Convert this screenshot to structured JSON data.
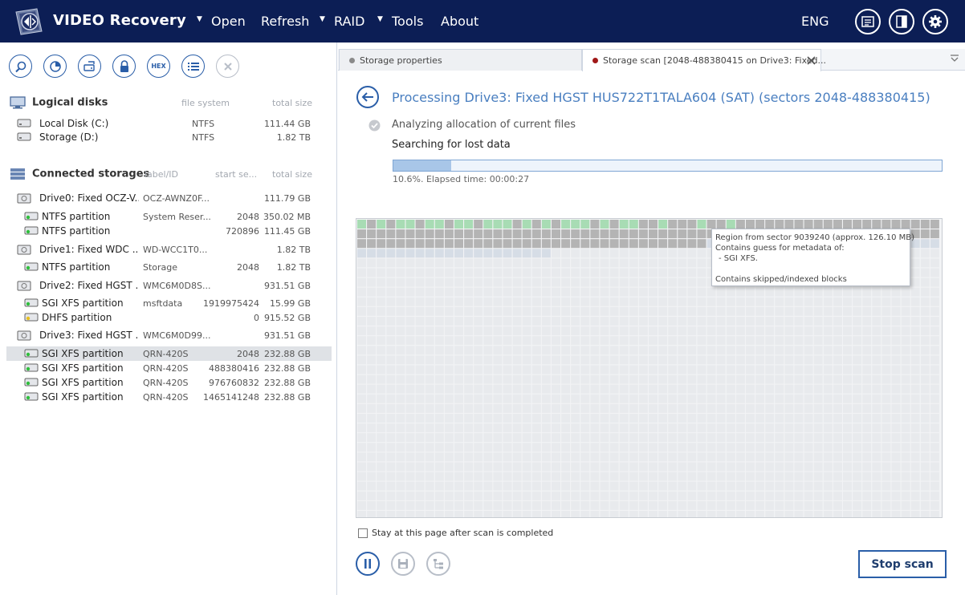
{
  "app": {
    "title": "VIDEO Recovery",
    "language": "ENG"
  },
  "menu": [
    {
      "label": "Open",
      "has_dropdown": true
    },
    {
      "label": "Refresh",
      "has_dropdown": false
    },
    {
      "label": "RAID",
      "has_dropdown": true
    },
    {
      "label": "Tools",
      "has_dropdown": true
    },
    {
      "label": "About",
      "has_dropdown": false
    }
  ],
  "titlebar_icons": [
    "messages-icon",
    "panel-layout-icon",
    "settings-gear-icon"
  ],
  "toolbar_icons": [
    "find-search-icon",
    "scan-icon",
    "disk-image-icon",
    "lock-icon",
    "hex-icon",
    "list-icon",
    "close-icon"
  ],
  "toolbar_hex_label": "HEX",
  "logical_disks": {
    "header": "Logical disks",
    "col_fs": "file system",
    "col_size": "total size",
    "items": [
      {
        "name": "Local Disk (C:)",
        "fs": "NTFS",
        "size": "111.44 GB"
      },
      {
        "name": "Storage (D:)",
        "fs": "NTFS",
        "size": "1.82 TB"
      }
    ]
  },
  "connected_storages": {
    "header": "Connected storages",
    "col_label": "label/ID",
    "col_start": "start se...",
    "col_size": "total size",
    "items": [
      {
        "type": "drive",
        "name": "Drive0: Fixed OCZ-V...",
        "label": "OCZ-AWNZ0F...",
        "start": "",
        "size": "111.79 GB"
      },
      {
        "type": "partition",
        "name": "NTFS partition",
        "label": "System Reser...",
        "start": "2048",
        "size": "350.02 MB",
        "dot": "green"
      },
      {
        "type": "partition",
        "name": "NTFS partition",
        "label": "",
        "start": "720896",
        "size": "111.45 GB",
        "dot": "green"
      },
      {
        "type": "drive",
        "name": "Drive1: Fixed WDC ...",
        "label": "WD-WCC1T0...",
        "start": "",
        "size": "1.82 TB"
      },
      {
        "type": "partition",
        "name": "NTFS partition",
        "label": "Storage",
        "start": "2048",
        "size": "1.82 TB",
        "dot": "green"
      },
      {
        "type": "drive",
        "name": "Drive2: Fixed HGST ...",
        "label": "WMC6M0D8S...",
        "start": "",
        "size": "931.51 GB"
      },
      {
        "type": "partition",
        "name": "SGI XFS partition",
        "label": "msftdata",
        "start": "1919975424",
        "size": "15.99 GB",
        "dot": "green"
      },
      {
        "type": "partition",
        "name": "DHFS partition",
        "label": "",
        "start": "0",
        "size": "915.52 GB",
        "dot": "yellow"
      },
      {
        "type": "drive",
        "name": "Drive3: Fixed HGST ...",
        "label": "WMC6M0D99...",
        "start": "",
        "size": "931.51 GB"
      },
      {
        "type": "partition",
        "name": "SGI XFS partition",
        "label": "QRN-420S",
        "start": "2048",
        "size": "232.88 GB",
        "dot": "green",
        "selected": true
      },
      {
        "type": "partition",
        "name": "SGI XFS partition",
        "label": "QRN-420S",
        "start": "488380416",
        "size": "232.88 GB",
        "dot": "green"
      },
      {
        "type": "partition",
        "name": "SGI XFS partition",
        "label": "QRN-420S",
        "start": "976760832",
        "size": "232.88 GB",
        "dot": "green"
      },
      {
        "type": "partition",
        "name": "SGI XFS partition",
        "label": "QRN-420S",
        "start": "1465141248",
        "size": "232.88 GB",
        "dot": "green"
      }
    ]
  },
  "tabs": [
    {
      "label": "Storage properties",
      "dot_color": "#8a8a8a",
      "active": false
    },
    {
      "label": "Storage scan [2048-488380415 on Drive3: Fixed...",
      "dot_color": "#a01818",
      "active": true
    }
  ],
  "scan": {
    "title": "Processing Drive3: Fixed HGST HUS722T1TALA604 (SAT) (sectors 2048-488380415)",
    "step_done": "Analyzing allocation of current files",
    "step_current": "Searching for lost data",
    "progress_fraction": 0.106,
    "progress_text": "10.6%. Elapsed time: 00:00:27",
    "tooltip_lines": [
      "Region from sector 9039240 (approx. 126.10 MB)",
      "Contains guess for metadata of:",
      "- SGI XFS.",
      "",
      "Contains skipped/indexed blocks"
    ],
    "stay_label": "Stay at this page after scan is completed",
    "stay_checked": false,
    "stop_label": "Stop scan"
  },
  "colors": {
    "titlebar": "#0c1e55",
    "accent": "#2a5ea8",
    "title_text": "#4a7fc0",
    "block_scanned": "#b4b4b4",
    "block_found": "#a8dcb4",
    "block_indexed": "#d6dde6",
    "block_pending": "#e8eaed"
  }
}
